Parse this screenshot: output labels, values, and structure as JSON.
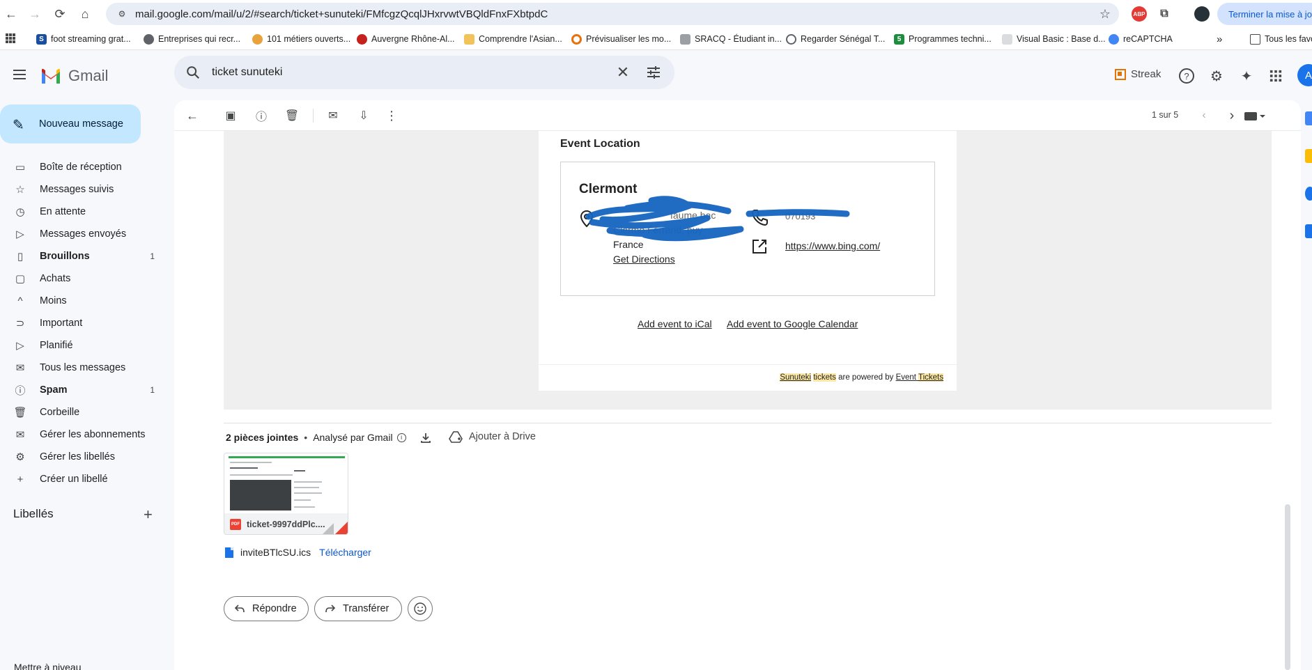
{
  "browser": {
    "url": "mail.google.com/mail/u/2/#search/ticket+sunuteki/FMfcgzQcqlJHxrvwtVBQldFnxFXbtpdC",
    "update_button": "Terminer la mise à jour",
    "ext_abp": "ABP",
    "bookmarks": [
      {
        "label": "foot streaming grat...",
        "color": "#1a4fa0"
      },
      {
        "label": "Entreprises qui recr...",
        "color": "#5f6368"
      },
      {
        "label": "101 métiers ouverts...",
        "color": "#e8a33d"
      },
      {
        "label": "Auvergne Rhône-Al...",
        "color": "#c5221f"
      },
      {
        "label": "Comprendre l'Asian...",
        "color": "#f2c35a"
      },
      {
        "label": "Prévisualiser les mo...",
        "color": "#e8710a"
      },
      {
        "label": "SRACQ - Étudiant in...",
        "color": "#5f6368"
      },
      {
        "label": "Regarder Sénégal T...",
        "color": "#5f6368"
      },
      {
        "label": "Programmes techni...",
        "color": "#1e8e3e"
      },
      {
        "label": "Visual Basic : Base d...",
        "color": "#9aa0a6"
      },
      {
        "label": "reCAPTCHA",
        "color": "#4285f4"
      }
    ],
    "bookmarks_more": "»",
    "all_bookmarks": "Tous les favo"
  },
  "gmail": {
    "logo_text": "Gmail",
    "search_value": "ticket sunuteki",
    "streak_label": "Streak",
    "avatar_letter": "A",
    "compose_label": "Nouveau message",
    "nav": [
      {
        "label": "Boîte de réception",
        "icon": "inbox-icon",
        "glyph": "▭",
        "count": ""
      },
      {
        "label": "Messages suivis",
        "icon": "star-icon",
        "glyph": "☆",
        "count": ""
      },
      {
        "label": "En attente",
        "icon": "clock-icon",
        "glyph": "◷",
        "count": ""
      },
      {
        "label": "Messages envoyés",
        "icon": "send-icon",
        "glyph": "▷",
        "count": ""
      },
      {
        "label": "Brouillons",
        "icon": "draft-icon",
        "glyph": "▯",
        "count": "1",
        "bold": true
      },
      {
        "label": "Achats",
        "icon": "shopping-bag-icon",
        "glyph": "▢",
        "count": ""
      },
      {
        "label": "Moins",
        "icon": "chevron-up-icon",
        "glyph": "^",
        "count": ""
      },
      {
        "label": "Important",
        "icon": "important-icon",
        "glyph": "⊃",
        "count": ""
      },
      {
        "label": "Planifié",
        "icon": "scheduled-icon",
        "glyph": "▷",
        "count": ""
      },
      {
        "label": "Tous les messages",
        "icon": "all-mail-icon",
        "glyph": "✉",
        "count": ""
      },
      {
        "label": "Spam",
        "icon": "spam-icon",
        "glyph": "ⓘ",
        "count": "1",
        "bold": true
      },
      {
        "label": "Corbeille",
        "icon": "trash-icon",
        "glyph": "🗑",
        "count": ""
      },
      {
        "label": "Gérer les abonnements",
        "icon": "subscriptions-icon",
        "glyph": "✉",
        "count": ""
      },
      {
        "label": "Gérer les libellés",
        "icon": "gear-icon",
        "glyph": "⚙",
        "count": ""
      },
      {
        "label": "Créer un libellé",
        "icon": "plus-icon",
        "glyph": "+",
        "count": ""
      }
    ],
    "labels_title": "Libellés",
    "nav_bottom": "Mettre à niveau"
  },
  "toolbar": {
    "pager": "1 sur 5"
  },
  "email": {
    "event_location_title": "Event Location",
    "location_name": "Clermont",
    "address_line1": "faume bac",
    "address_line2": "Clermo    Ferrand, puy",
    "address_line3": "France",
    "get_directions": "Get Directions",
    "phone_partial": "070193",
    "website": "https://www.bing.com/",
    "add_ical": "Add event to iCal",
    "add_gcal": "Add event to Google Calendar",
    "powered_sunuteki": "Sunuteki",
    "powered_tickets": "tickets",
    "powered_mid": " are powered by ",
    "powered_event": "Event",
    "powered_event_tickets": "Tickets"
  },
  "attachments": {
    "count_label": "2 pièces jointes",
    "scanned": "Analysé par Gmail",
    "add_drive": "Ajouter à Drive",
    "pdf_name": "ticket-9997ddPlc....",
    "pdf_badge": "PDF",
    "ics_name": "inviteBTlcSU.ics",
    "ics_download": "Télécharger"
  },
  "actions": {
    "reply": "Répondre",
    "forward": "Transférer"
  }
}
